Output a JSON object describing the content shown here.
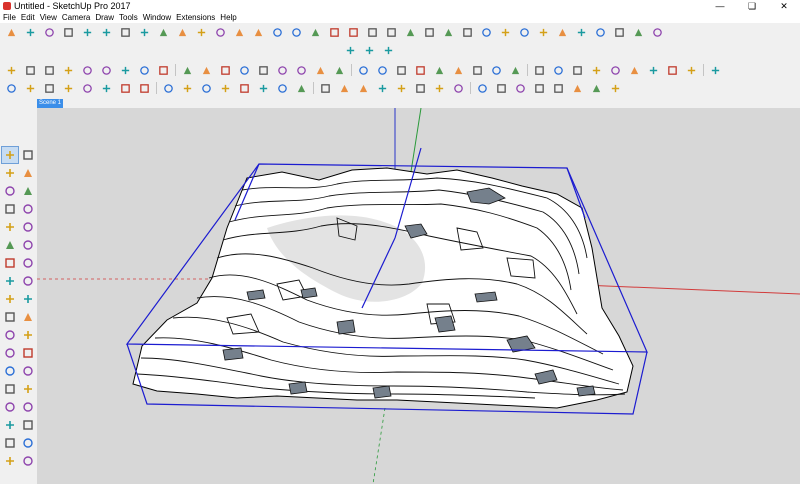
{
  "window": {
    "title": "Untitled - SketchUp Pro 2017",
    "minimize": "—",
    "restore": "❏",
    "close": "✕"
  },
  "menu": [
    "File",
    "Edit",
    "View",
    "Camera",
    "Draw",
    "Tools",
    "Window",
    "Extensions",
    "Help"
  ],
  "scene_tab": "Scene 1",
  "toolbars": {
    "row1": [
      "push-pull-icon",
      "follow-me-icon",
      "offset-icon",
      "move-icon",
      "rotate-icon",
      "scale-icon",
      "intersect-icon",
      "outer-shell-icon",
      "union-icon",
      "subtract-icon",
      "trim-icon",
      "split-icon",
      "sandbox-from-contours-icon",
      "sandbox-from-scratch-icon",
      "smoove-icon",
      "stamp-icon",
      "drape-icon",
      "add-detail-icon",
      "flip-edge-icon",
      "line-icon",
      "arc-icon",
      "freehand-icon",
      "rectangle-icon",
      "circle-icon",
      "polygon-icon",
      "pie-icon",
      "tape-measure-icon",
      "dimension-icon",
      "protractor-icon",
      "text-icon",
      "axes-icon",
      "section-plane-icon",
      "3d-text-icon",
      "paint-bucket-icon",
      "eraser-icon"
    ],
    "row2": [
      "components-icon",
      "materials-icon",
      "location-icon"
    ],
    "row3": [
      "select-icon",
      "eraser-icon",
      "orbit-icon",
      "pan-icon",
      "zoom-icon",
      "zoom-window-icon",
      "zoom-extents-icon",
      "previous-view-icon",
      "look-around-icon",
      "walk-icon",
      "position-camera-icon",
      "iso-view-icon",
      "top-view-icon",
      "front-view-icon",
      "right-view-icon",
      "back-view-icon",
      "left-view-icon",
      "xray-icon",
      "back-edges-icon",
      "wireframe-icon",
      "hidden-line-icon",
      "shaded-icon",
      "shaded-textures-icon",
      "monochrome-icon",
      "shadows-icon",
      "fog-icon",
      "section-cut-icon",
      "section-fill-icon",
      "display-sections-icon",
      "edge-style-icon",
      "profiles-icon",
      "depth-cue-icon",
      "extension-icon",
      "extension-icon",
      "warehouse-icon",
      "extension-warehouse-icon",
      "layout-icon"
    ],
    "row4": [
      "standard-new-icon",
      "standard-open-icon",
      "standard-save-icon",
      "cut-icon",
      "copy-icon",
      "paste-icon",
      "erase-icon",
      "undo-icon",
      "redo-icon",
      "print-icon",
      "model-info-icon",
      "solid-tools-icon",
      "sandbox-icon",
      "views-icon",
      "styles-icon",
      "layers-icon",
      "shadows-icon",
      "sections-icon",
      "warehouse-share-icon",
      "component-share-icon",
      "get-models-icon",
      "dynamic-components-icon",
      "interact-icon",
      "component-options-icon",
      "component-attributes-icon",
      "send-to-layout-icon",
      "export-icon",
      "ruby-console-icon",
      "photo-match-icon",
      "geo-location-icon",
      "terrain-icon",
      "preview-icon"
    ]
  },
  "left_toolbar": [
    [
      "select-icon",
      "make-component-icon"
    ],
    [
      "paint-bucket-icon",
      "eraser-icon"
    ],
    [
      "line-icon",
      "freehand-icon"
    ],
    [
      "rectangle-icon",
      "rotated-rectangle-icon"
    ],
    [
      "circle-icon",
      "polygon-icon"
    ],
    [
      "arc-icon",
      "two-point-arc-icon"
    ],
    [
      "three-point-arc-icon",
      "pie-icon"
    ],
    [
      "move-icon",
      "push-pull-icon"
    ],
    [
      "rotate-icon",
      "follow-me-icon"
    ],
    [
      "scale-icon",
      "offset-icon"
    ],
    [
      "tape-measure-icon",
      "dimension-icon"
    ],
    [
      "protractor-icon",
      "text-icon"
    ],
    [
      "axes-icon",
      "3d-text-icon"
    ],
    [
      "orbit-icon",
      "pan-icon"
    ],
    [
      "zoom-icon",
      "zoom-window-icon"
    ],
    [
      "zoom-extents-icon",
      "previous-icon"
    ],
    [
      "position-camera-icon",
      "look-around-icon"
    ],
    [
      "walk-icon",
      "section-plane-icon"
    ]
  ],
  "colors": {
    "accent": "#3b8ee9",
    "axis_red": "#d23b3b",
    "axis_green": "#2a9a3a",
    "axis_blue": "#2a36c8",
    "bounding_box": "#1c1cd0",
    "viewport_bg": "#d7d7d7"
  }
}
